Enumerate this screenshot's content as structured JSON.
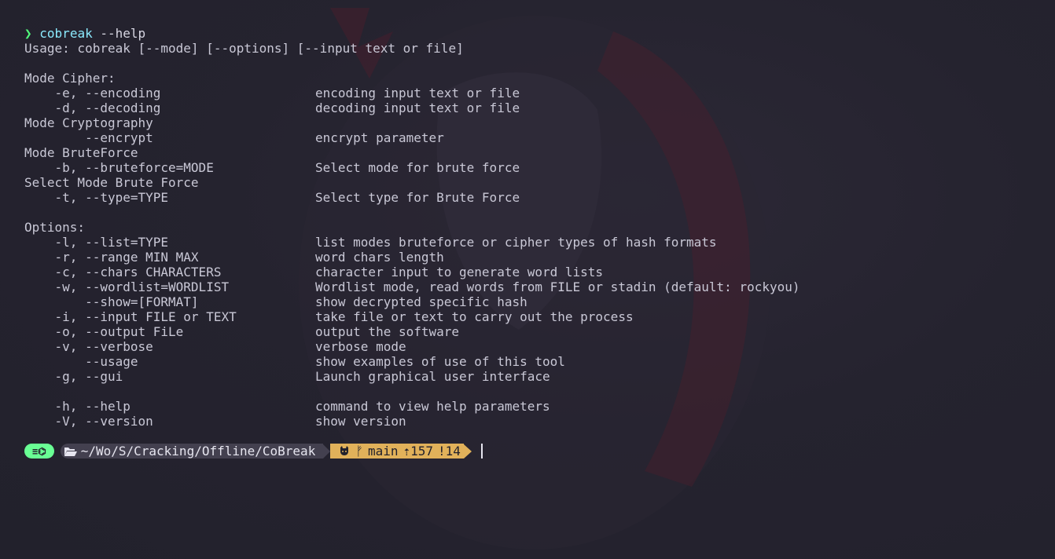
{
  "colors": {
    "background": "#22212c",
    "foreground": "#c9c8d6",
    "prompt_symbol": "#50fa7b",
    "command": "#8be9fd",
    "os_segment": "#69ff94",
    "path_segment": "#43404f",
    "git_segment": "#e1b15a",
    "art_accent": "#6b2233"
  },
  "command_line": {
    "symbol": "❯",
    "command": "cobreak",
    "args": " --help"
  },
  "usage": "Usage: cobreak [--mode] [--options] [--input text or file]",
  "sections": {
    "cipher_title": "Mode Cipher:",
    "cipher_rows": [
      {
        "flag": "    -e, --encoding",
        "desc": "encoding input text or file"
      },
      {
        "flag": "    -d, --decoding",
        "desc": "decoding input text or file"
      }
    ],
    "crypto_title": "Mode Cryptography",
    "crypto_rows": [
      {
        "flag": "        --encrypt",
        "desc": "encrypt parameter"
      }
    ],
    "brute_title": "Mode BruteForce",
    "brute_rows": [
      {
        "flag": "    -b, --bruteforce=MODE",
        "desc": "Select mode for brute force"
      }
    ],
    "select_title": "Select Mode Brute Force",
    "select_rows": [
      {
        "flag": "    -t, --type=TYPE",
        "desc": "Select type for Brute Force"
      }
    ],
    "options_title": "Options:",
    "options_rows": [
      {
        "flag": "    -l, --list=TYPE",
        "desc": "list modes bruteforce or cipher types of hash formats"
      },
      {
        "flag": "    -r, --range MIN MAX",
        "desc": "word chars length"
      },
      {
        "flag": "    -c, --chars CHARACTERS",
        "desc": "character input to generate word lists"
      },
      {
        "flag": "    -w, --wordlist=WORDLIST",
        "desc": "Wordlist mode, read words from FILE or stadin (default: rockyou)"
      },
      {
        "flag": "        --show=[FORMAT]",
        "desc": "show decrypted specific hash"
      },
      {
        "flag": "    -i, --input FILE or TEXT",
        "desc": "take file or text to carry out the process"
      },
      {
        "flag": "    -o, --output FiLe",
        "desc": "output the software"
      },
      {
        "flag": "    -v, --verbose",
        "desc": "verbose mode"
      },
      {
        "flag": "        --usage",
        "desc": "show examples of use of this tool"
      },
      {
        "flag": "    -g, --gui",
        "desc": "Launch graphical user interface"
      }
    ],
    "help_rows": [
      {
        "flag": "    -h, --help",
        "desc": "command to view help parameters"
      },
      {
        "flag": "    -V, --version",
        "desc": "show version"
      }
    ]
  },
  "prompt": {
    "os_segment": "≡⌬",
    "folder_icon": "folder-open-icon",
    "path": "~/Wo/S/Cracking/Offline/CoBreak",
    "git_icon": "github-icon",
    "branch_icon": "git-branch-icon",
    "branch_symbol": "ᚠ",
    "branch": "main",
    "ahead": "⇡157",
    "modified": "!14"
  }
}
